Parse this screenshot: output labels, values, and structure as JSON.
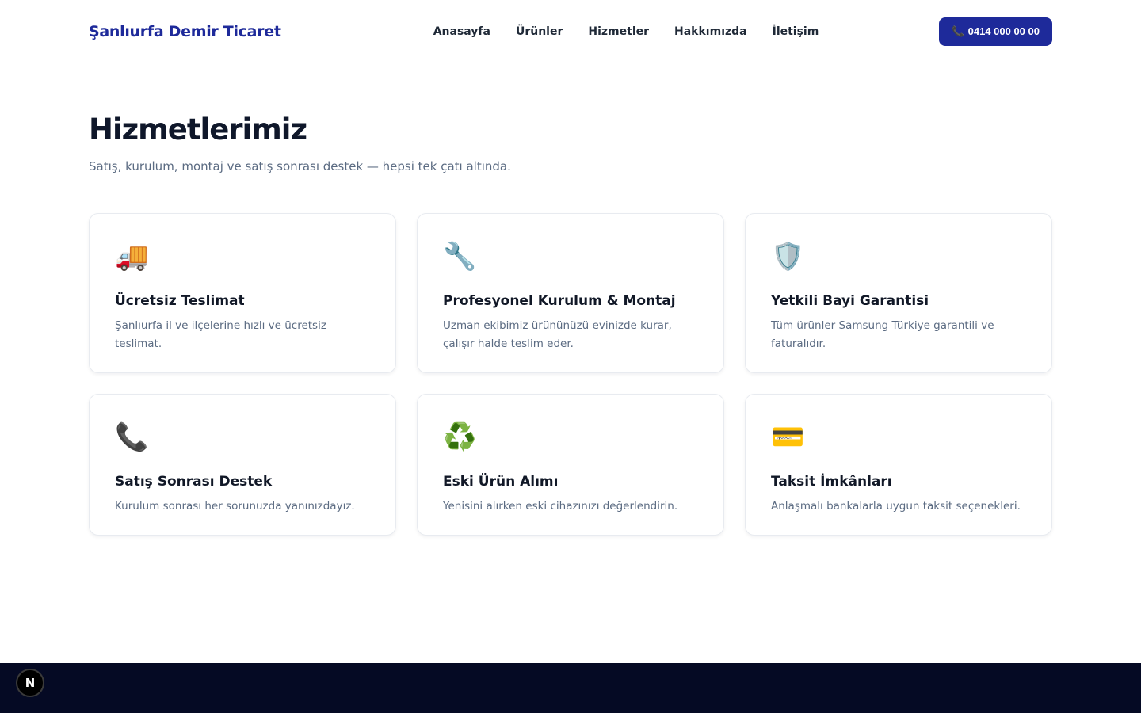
{
  "header": {
    "brand": "Şanlıurfa Demir Ticaret",
    "nav": [
      "Anasayfa",
      "Ürünler",
      "Hizmetler",
      "Hakkımızda",
      "İletişim"
    ],
    "call_icon": "📞",
    "call_label": "0414 000 00 00"
  },
  "main": {
    "title": "Hizmetlerimiz",
    "subtitle": "Satış, kurulum, montaj ve satış sonrası destek — hepsi tek çatı altında.",
    "services": [
      {
        "icon": "🚚",
        "icon_name": "delivery-truck-icon",
        "title": "Ücretsiz Teslimat",
        "desc": "Şanlıurfa il ve ilçelerine hızlı ve ücretsiz teslimat."
      },
      {
        "icon": "🔧",
        "icon_name": "wrench-icon",
        "title": "Profesyonel Kurulum & Montaj",
        "desc": "Uzman ekibimiz ürününüzü evinizde kurar, çalışır halde teslim eder."
      },
      {
        "icon": "🛡️",
        "icon_name": "shield-icon",
        "title": "Yetkili Bayi Garantisi",
        "desc": "Tüm ürünler Samsung Türkiye garantili ve faturalıdır."
      },
      {
        "icon": "📞",
        "icon_name": "telephone-icon",
        "title": "Satış Sonrası Destek",
        "desc": "Kurulum sonrası her sorunuzda yanınızdayız."
      },
      {
        "icon": "♻️",
        "icon_name": "recycle-icon",
        "title": "Eski Ürün Alımı",
        "desc": "Yenisini alırken eski cihazınızı değerlendirin."
      },
      {
        "icon": "💳",
        "icon_name": "credit-card-icon",
        "title": "Taksit İmkânları",
        "desc": "Anlaşmalı bankalarla uygun taksit seçenekleri."
      }
    ]
  },
  "badge": {
    "label": "N"
  },
  "colors": {
    "brand": "#1e2a9a",
    "footer": "#050a24",
    "text": "#0f172a",
    "muted": "#5b6b82"
  }
}
